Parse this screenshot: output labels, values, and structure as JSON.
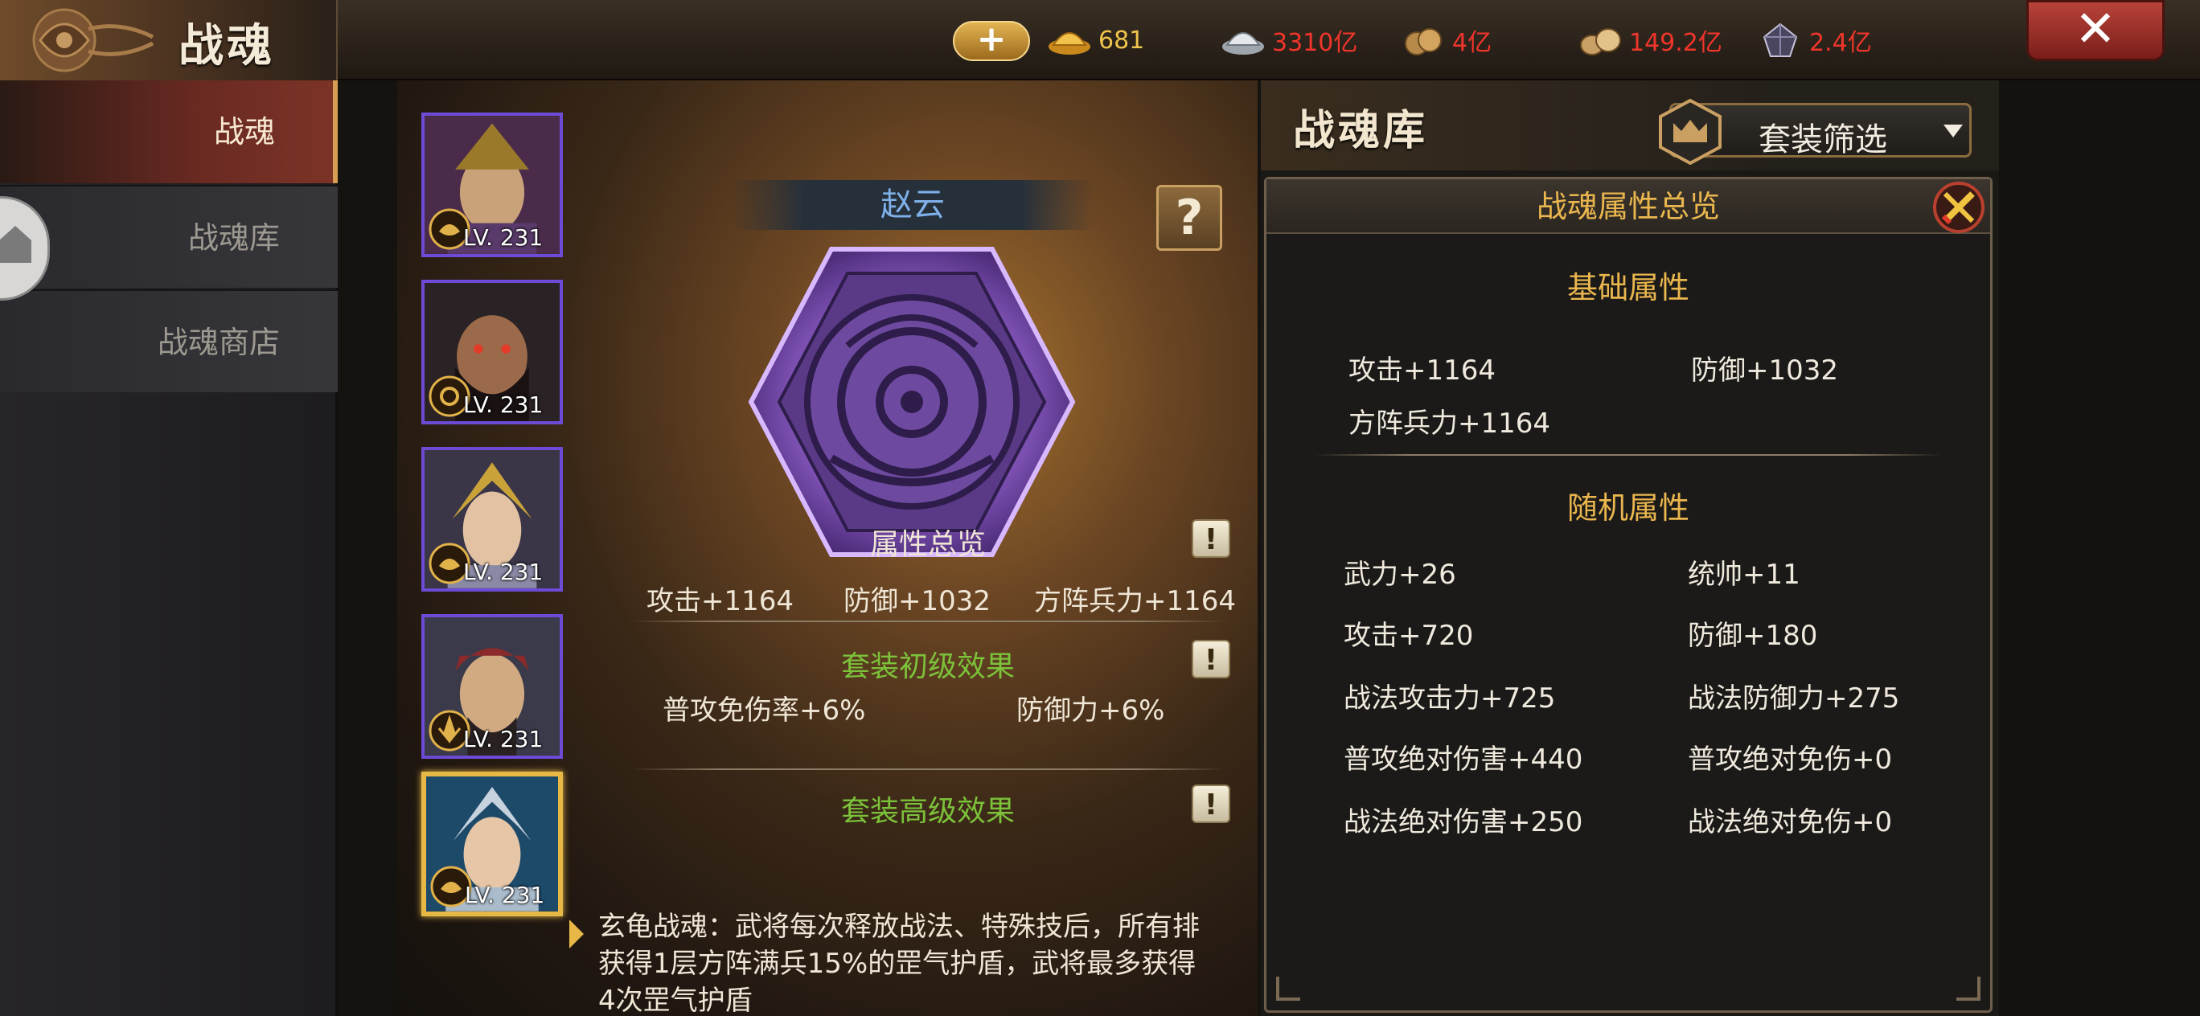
{
  "header": {
    "title": "战魂",
    "add_symbol": "+",
    "close_symbol": "✕",
    "resources": [
      {
        "icon": "gold-ingot-icon",
        "value": "681",
        "color": "#f0c44c"
      },
      {
        "icon": "silver-ingot-icon",
        "value": "3310亿",
        "color": "#f0352b"
      },
      {
        "icon": "grain-sack-icon",
        "value": "4亿",
        "color": "#f0352b"
      },
      {
        "icon": "coin-bag-icon",
        "value": "149.2亿",
        "color": "#f0352b"
      },
      {
        "icon": "crystal-icon",
        "value": "2.4亿",
        "color": "#f0352b"
      }
    ]
  },
  "sidebar": {
    "items": [
      {
        "label": "战魂",
        "active": true
      },
      {
        "label": "战魂库",
        "active": false
      },
      {
        "label": "战魂商店",
        "active": false
      }
    ]
  },
  "heroes": [
    {
      "level": "LV. 231"
    },
    {
      "level": "LV. 231"
    },
    {
      "level": "LV. 231"
    },
    {
      "level": "LV. 231"
    },
    {
      "level": "LV. 231",
      "selected": true
    }
  ],
  "detail": {
    "hero_name": "赵云",
    "help_symbol": "?",
    "info_symbol": "!",
    "overview_title": "属性总览",
    "overview_stats": [
      "攻击+1164",
      "防御+1032",
      "方阵兵力+1164"
    ],
    "set_basic_title": "套装初级效果",
    "set_basic_stats": [
      "普攻免伤率+6%",
      "防御力+6%"
    ],
    "set_advanced_title": "套装高级效果",
    "set_advanced_desc": "玄龟战魂：武将每次释放战法、特殊技后，所有排获得1层方阵满兵15%的罡气护盾，武将最多获得4次罡气护盾"
  },
  "library": {
    "title": "战魂库",
    "filter_label": "套装筛选",
    "panel_title": "战魂属性总览",
    "basic_title": "基础属性",
    "basic_stats": [
      "攻击+1164",
      "防御+1032",
      "方阵兵力+1164"
    ],
    "random_title": "随机属性",
    "random_stats": [
      "武力+26",
      "统帅+11",
      "攻击+720",
      "防御+180",
      "战法攻击力+725",
      "战法防御力+275",
      "普攻绝对伤害+440",
      "普攻绝对免伤+0",
      "战法绝对伤害+250",
      "战法绝对免伤+0"
    ]
  },
  "colors": {
    "accent_gold": "#eab64e",
    "set_green": "#7cc23a",
    "hero_name_blue": "#7fb0ea",
    "resource_red": "#f0352b"
  }
}
